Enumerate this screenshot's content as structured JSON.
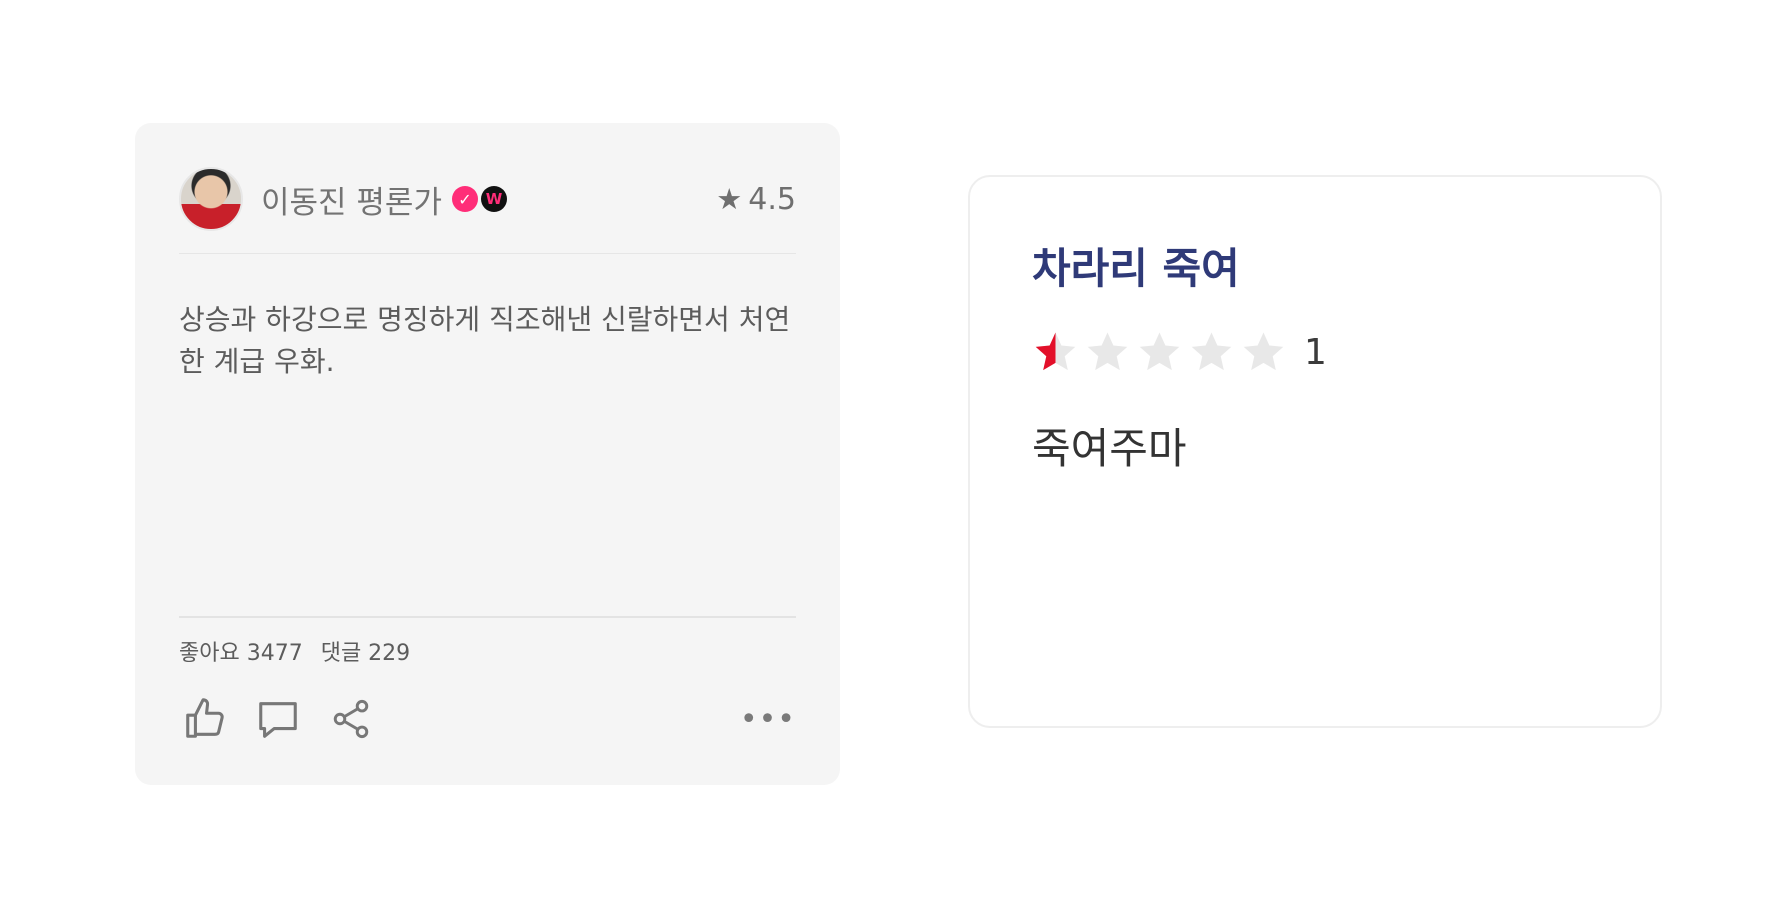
{
  "left_review": {
    "author": "이동진 평론가",
    "badges": [
      "verified-check-icon",
      "w-badge-icon"
    ],
    "rating": "4.5",
    "text": "상승과 하강으로 명징하게 직조해낸 신랄하면서 처연한 계급 우화.",
    "likes_label": "좋아요 3477",
    "comments_label": "댓글 229",
    "actions": [
      "thumbs-up-icon",
      "comment-icon",
      "share-icon",
      "more-icon"
    ]
  },
  "right_review": {
    "title": "차라리 죽여",
    "rating_value": 0.5,
    "rating_max": 5,
    "score_label": "1",
    "comment": "죽여주마"
  },
  "colors": {
    "accent_pink": "#ff2d78",
    "title_navy": "#2f3a78",
    "star_red": "#e3102a",
    "star_empty": "#e8e8e8"
  }
}
